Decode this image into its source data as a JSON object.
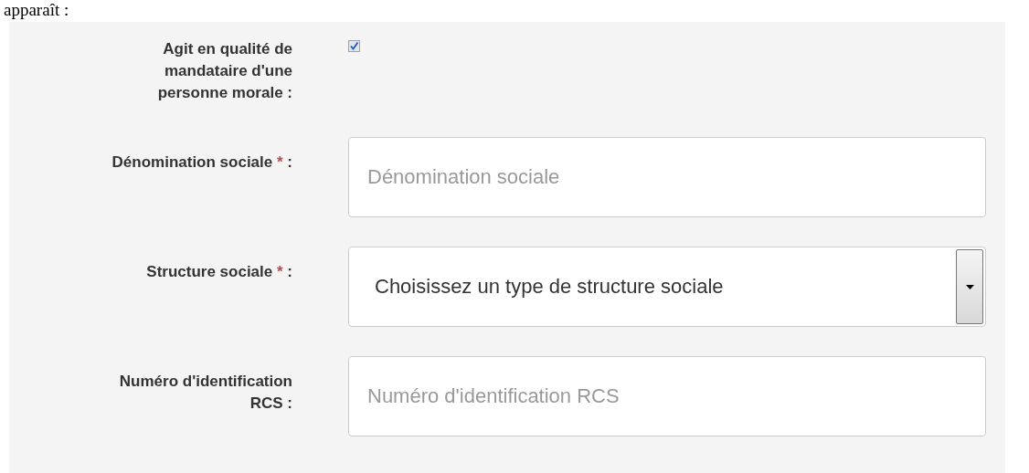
{
  "intro_text": "apparaît :",
  "form": {
    "rows": [
      {
        "kind": "checkbox",
        "label": "Agit en qualité de mandataire d'une personne morale :",
        "checked": true
      },
      {
        "kind": "text",
        "label": "Dénomination sociale",
        "required_mark": "*",
        "label_end": ":",
        "placeholder": "Dénomination sociale"
      },
      {
        "kind": "select",
        "label": "Structure sociale",
        "required_mark": "*",
        "label_end": ":",
        "value": "Choisissez un type de structure sociale"
      },
      {
        "kind": "text",
        "label": "Numéro d'identification RCS",
        "label_end": ":",
        "placeholder": "Numéro d'identification RCS"
      }
    ]
  }
}
